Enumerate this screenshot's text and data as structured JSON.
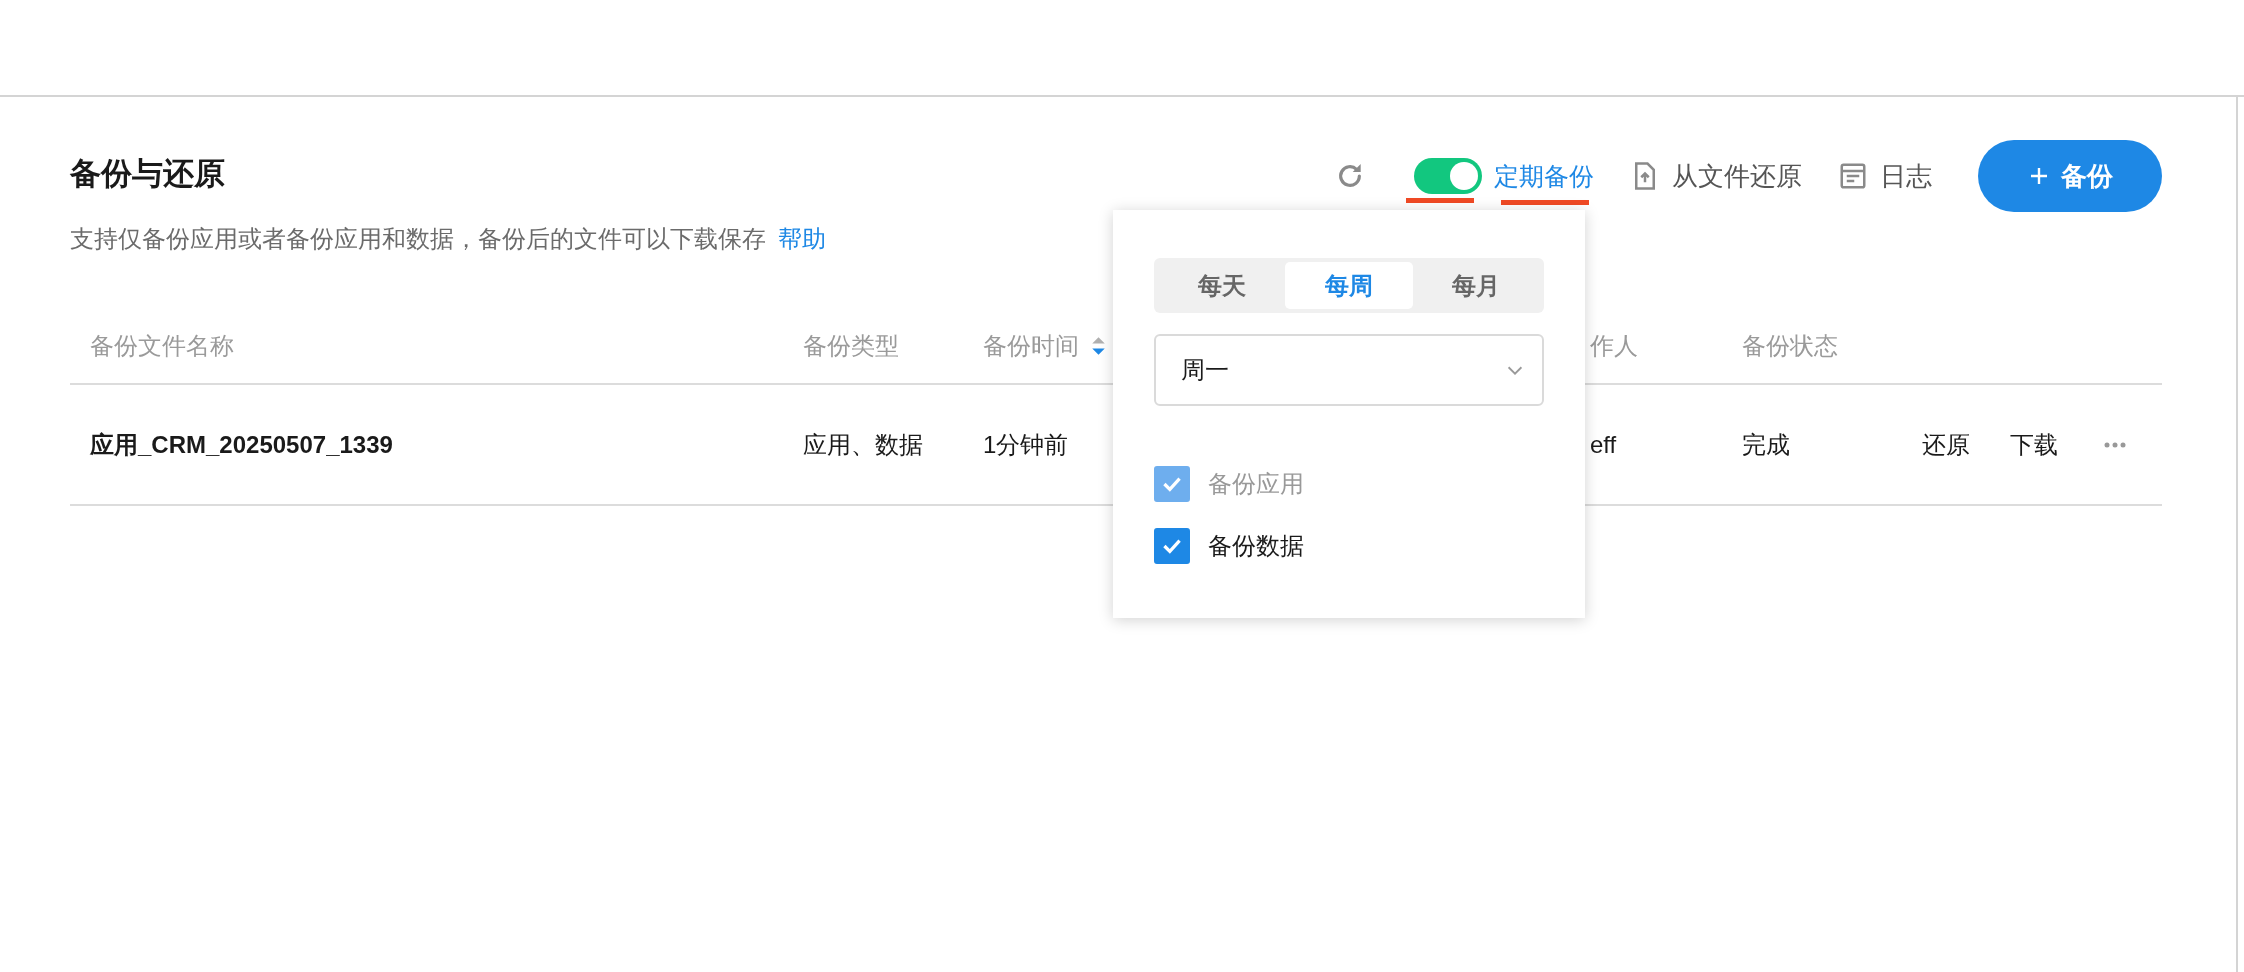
{
  "header": {
    "title": "备份与还原",
    "description": "支持仅备份应用或者备份应用和数据，备份后的文件可以下载保存",
    "help_link": "帮助"
  },
  "toolbar": {
    "schedule_toggle": {
      "on": true,
      "marked": true
    },
    "schedule_link": {
      "label": "定期备份",
      "marked": true
    },
    "restore_from_file": "从文件还原",
    "log": "日志",
    "backup_button": "备份"
  },
  "table": {
    "columns": [
      {
        "label": "备份文件名称",
        "sortable": false
      },
      {
        "label": "备份类型",
        "sortable": false
      },
      {
        "label": "备份时间",
        "sortable": true,
        "sorted_descending": true
      },
      {
        "label": "作人",
        "sortable": false
      },
      {
        "label": "备份状态",
        "sortable": false
      }
    ],
    "rows": [
      {
        "cells": [
          "应用_CRM_20250507_1339",
          "应用、数据",
          "1分钟前",
          "eff",
          "完成"
        ],
        "actions": [
          "还原",
          "下载"
        ]
      }
    ]
  },
  "schedule_popover": {
    "frequency_tabs": [
      {
        "label": "每天",
        "selected": false
      },
      {
        "label": "每周",
        "selected": true
      },
      {
        "label": "每月",
        "selected": false
      }
    ],
    "day_select": {
      "value": "周一"
    },
    "options": [
      {
        "label": "备份应用",
        "checked": true,
        "disabled": true
      },
      {
        "label": "备份数据",
        "checked": true,
        "disabled": false
      }
    ]
  }
}
